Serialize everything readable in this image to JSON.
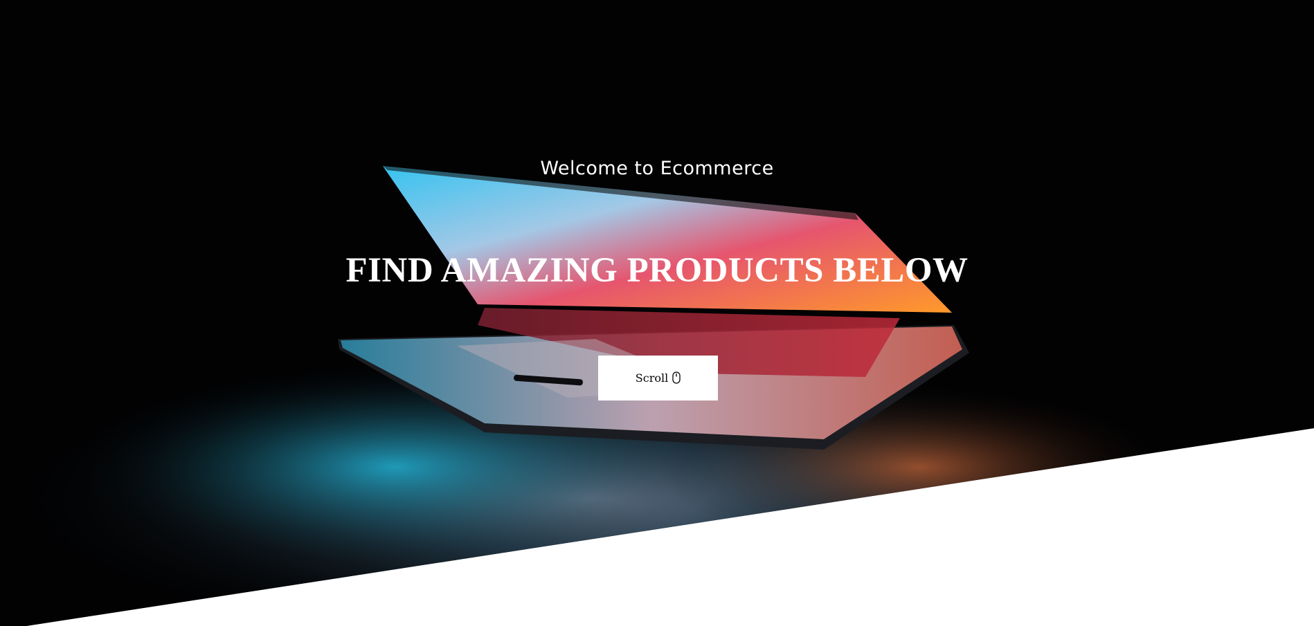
{
  "hero": {
    "welcome_text": "Welcome to Ecommerce",
    "headline": "FIND AMAZING PRODUCTS BELOW",
    "scroll_button": {
      "label": "Scroll",
      "icon": "mouse-icon"
    }
  },
  "colors": {
    "hero_background": "#000000",
    "text": "#ffffff",
    "button_background": "#ffffff",
    "button_text": "#000000",
    "page_background": "#ffffff",
    "screen_glow_cyan": "#29b6e8",
    "screen_glow_red": "#e8243a",
    "screen_glow_orange": "#ff8a2a"
  }
}
